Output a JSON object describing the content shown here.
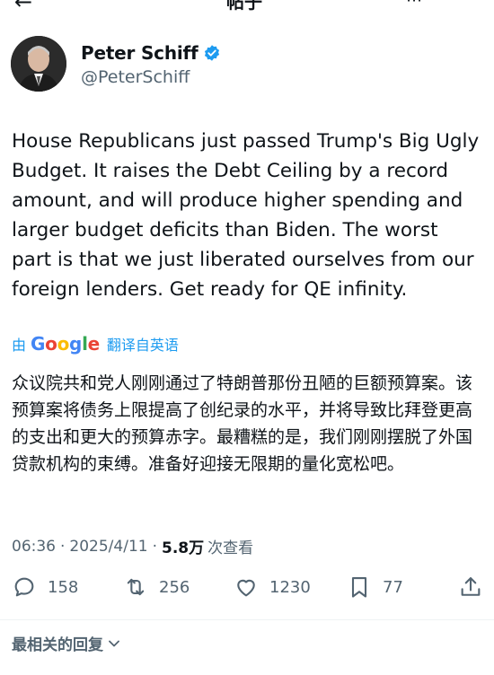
{
  "header": {
    "back_icon": "back-arrow-icon",
    "title": "帖子",
    "more_icon": "more-icon"
  },
  "author": {
    "name": "Peter Schiff",
    "handle": "@PeterSchiff",
    "verified_icon": "verified-badge-icon",
    "verified_color": "#1d9bf0"
  },
  "tweet": {
    "text": "House Republicans just passed Trump's Big Ugly Budget. It raises the Debt Ceiling by a record amount, and will produce higher spending and larger budget deficits than Biden. The worst part is that we just liberated ourselves from our foreign lenders. Get ready for QE infinity."
  },
  "translation": {
    "by": "由",
    "logo": "Google",
    "label": "翻译自英语",
    "text": "众议院共和党人刚刚通过了特朗普那份丑陋的巨额预算案。该预算案将债务上限提高了创纪录的水平，并将导致比拜登更高的支出和更大的预算赤字。最糟糕的是，我们刚刚摆脱了外国贷款机构的束缚。准备好迎接无限期的量化宽松吧。"
  },
  "meta": {
    "time": "06:36",
    "separator": "·",
    "date": "2025/4/11",
    "views": "5.8万",
    "views_label": "次查看"
  },
  "actions": {
    "replies": "158",
    "retweets": "256",
    "likes": "1230",
    "bookmarks": "77"
  },
  "replies_section": {
    "label": "最相关的回复"
  },
  "colors": {
    "accent": "#1d9bf0",
    "text": "#0f1419",
    "secondary": "#536471"
  }
}
